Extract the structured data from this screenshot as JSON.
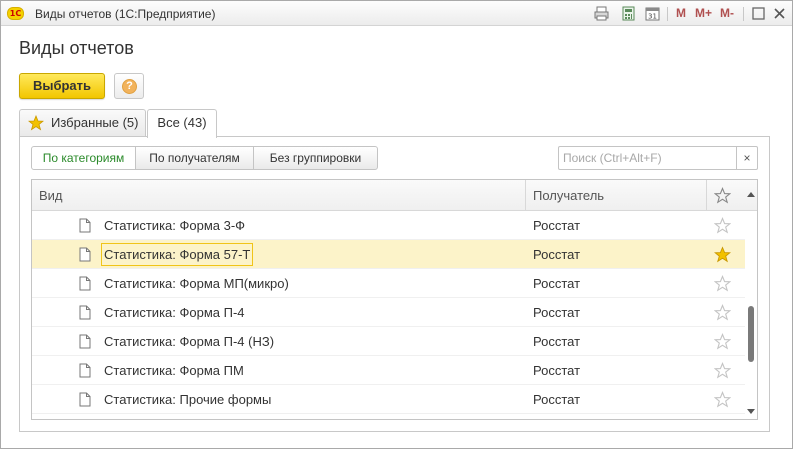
{
  "window": {
    "logo_text": "1С",
    "title": "Виды отчетов  (1С:Предприятие)",
    "memory_buttons": [
      "M",
      "M+",
      "M-"
    ]
  },
  "page": {
    "title": "Виды отчетов"
  },
  "toolbar": {
    "select_label": "Выбрать",
    "help_glyph": "?"
  },
  "tabs": [
    {
      "label": "Избранные (5)",
      "active": false
    },
    {
      "label": "Все (43)",
      "active": true
    }
  ],
  "grouping": [
    {
      "label": "По категориям",
      "active": true
    },
    {
      "label": "По получателям",
      "active": false
    },
    {
      "label": "Без группировки",
      "active": false
    }
  ],
  "search": {
    "placeholder": "Поиск (Ctrl+Alt+F)",
    "value": "",
    "clear_glyph": "×"
  },
  "table": {
    "columns": {
      "name": "Вид",
      "recipient": "Получатель"
    },
    "rows": [
      {
        "name": "Статистика: Форма 3-Ф",
        "recipient": "Росстат",
        "favorite": false,
        "selected": false
      },
      {
        "name": "Статистика: Форма 57-Т",
        "recipient": "Росстат",
        "favorite": true,
        "selected": true
      },
      {
        "name": "Статистика: Форма МП(микро)",
        "recipient": "Росстат",
        "favorite": false,
        "selected": false
      },
      {
        "name": "Статистика: Форма П-4",
        "recipient": "Росстат",
        "favorite": false,
        "selected": false
      },
      {
        "name": "Статистика: Форма П-4 (НЗ)",
        "recipient": "Росстат",
        "favorite": false,
        "selected": false
      },
      {
        "name": "Статистика: Форма ПМ",
        "recipient": "Росстат",
        "favorite": false,
        "selected": false
      },
      {
        "name": "Статистика: Прочие формы",
        "recipient": "Росстат",
        "favorite": false,
        "selected": false
      }
    ]
  },
  "colors": {
    "accent_yellow": "#f5c800",
    "favorite_star": "#f2c100",
    "selected_row": "#fcf3c9",
    "active_group_text": "#2a8a2a",
    "memory_text": "#b05050"
  },
  "icons": {
    "titlebar": [
      "print-icon",
      "calculator-icon",
      "calendar-icon",
      "minimize-icon",
      "close-icon"
    ],
    "row": "document-icon",
    "favorite": "star-icon"
  }
}
